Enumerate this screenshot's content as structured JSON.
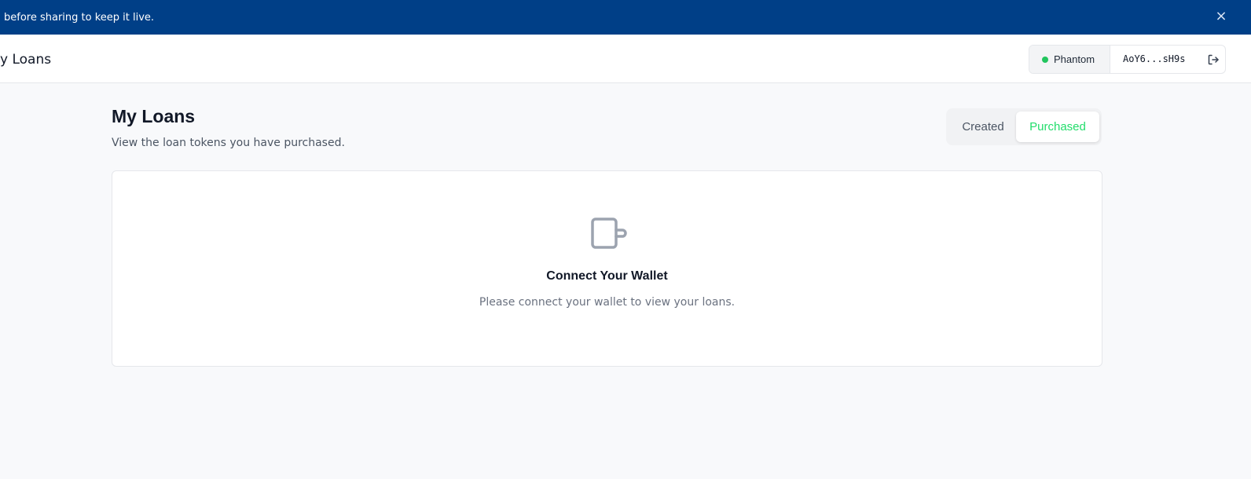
{
  "banner": {
    "text": "before sharing to keep it live.",
    "close_icon": "×"
  },
  "header": {
    "title": "y Loans",
    "wallet": {
      "name": "Phantom",
      "status_color": "#22c55e",
      "address": "AoY6...sH9s",
      "logout_icon": "logout-icon"
    }
  },
  "page": {
    "title": "My Loans",
    "subtitle": "View the loan tokens you have purchased.",
    "tabs": [
      {
        "label": "Created",
        "active": false
      },
      {
        "label": "Purchased",
        "active": true
      }
    ],
    "empty_state": {
      "icon": "wallet-icon",
      "title": "Connect Your Wallet",
      "message": "Please connect your wallet to view your loans."
    }
  },
  "colors": {
    "banner": "#003f87",
    "accent": "#22dd6b"
  }
}
